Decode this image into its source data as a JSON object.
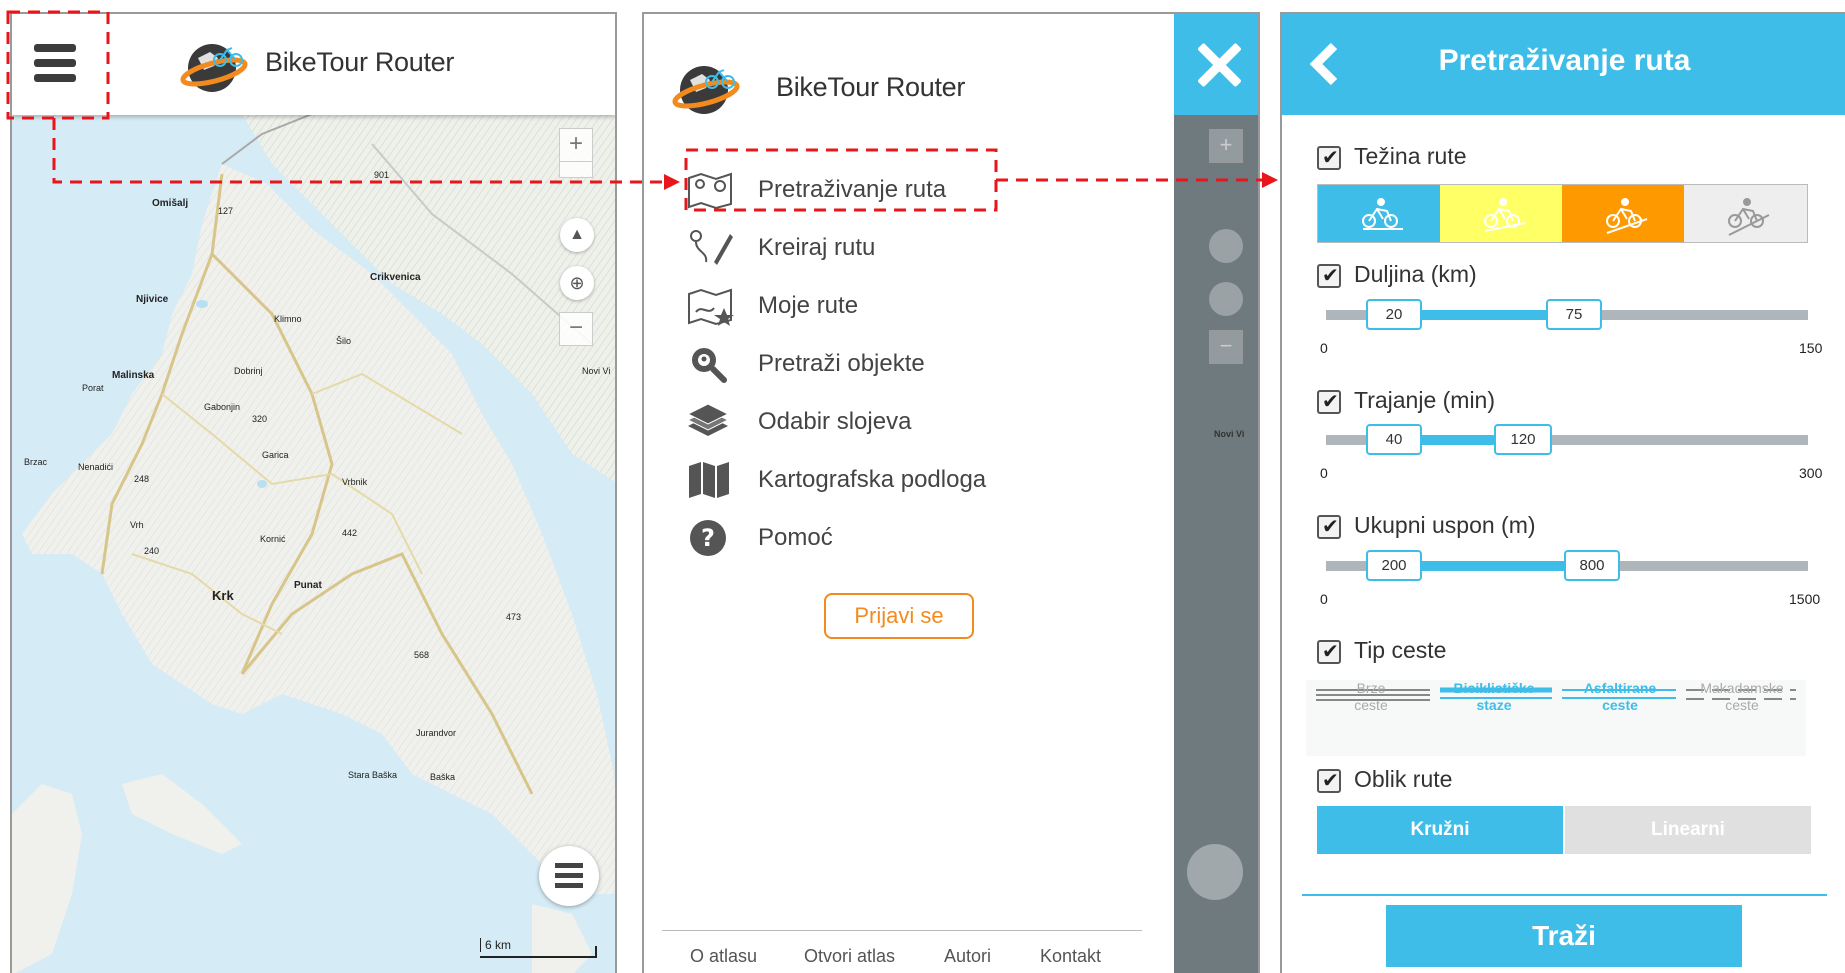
{
  "app": {
    "brand": "BikeTour Router"
  },
  "map": {
    "places": [
      "Omišalj",
      "Njivice",
      "Malinska",
      "Porat",
      "Dobrinj",
      "Gabonjin",
      "Brzac",
      "Nenadići",
      "Vrh",
      "Garica",
      "Vrbnik",
      "Kornić",
      "Krk",
      "Punat",
      "Stara Baška",
      "Baška",
      "Jurandvor",
      "Crikvenica",
      "Klimno",
      "Šilo",
      "Novi Vi"
    ],
    "elevations": [
      "901",
      "127",
      "320",
      "248",
      "240",
      "442",
      "473",
      "568"
    ],
    "scale": "6 km",
    "zoom_in": "+",
    "zoom_out": "−"
  },
  "menu": {
    "items": [
      {
        "label": "Pretraživanje ruta",
        "icon": "map-search-icon"
      },
      {
        "label": "Kreiraj rutu",
        "icon": "draw-route-icon"
      },
      {
        "label": "Moje rute",
        "icon": "my-routes-icon"
      },
      {
        "label": "Pretraži objekte",
        "icon": "magnifier-pin-icon"
      },
      {
        "label": "Odabir slojeva",
        "icon": "layers-icon"
      },
      {
        "label": "Kartografska podloga",
        "icon": "basemap-icon"
      },
      {
        "label": "Pomoć",
        "icon": "help-icon"
      }
    ],
    "login": "Prijavi se",
    "footer": [
      "O atlasu",
      "Otvori atlas",
      "Autori",
      "Kontakt"
    ]
  },
  "search": {
    "title": "Pretraživanje ruta",
    "difficulty": {
      "label": "Težina rute",
      "checked": true,
      "colors": [
        "#3dbde8",
        "#ffff66",
        "#ff9900",
        "#eeeeee"
      ]
    },
    "length": {
      "label": "Duljina (km)",
      "checked": true,
      "low": "20",
      "high": "75",
      "min": "0",
      "max": "150"
    },
    "duration": {
      "label": "Trajanje (min)",
      "checked": true,
      "low": "40",
      "high": "120",
      "min": "0",
      "max": "300"
    },
    "ascent": {
      "label": "Ukupni uspon (m)",
      "checked": true,
      "low": "200",
      "high": "800",
      "min": "0",
      "max": "1500"
    },
    "road_type": {
      "label": "Tip ceste",
      "checked": true,
      "types": [
        {
          "line1": "Brze",
          "line2": "ceste",
          "active": false
        },
        {
          "line1": "Biciklističke",
          "line2": "staze",
          "active": true
        },
        {
          "line1": "Asfaltirane",
          "line2": "ceste",
          "active": true
        },
        {
          "line1": "Makadamske",
          "line2": "ceste",
          "active": false
        }
      ]
    },
    "shape": {
      "label": "Oblik rute",
      "checked": true,
      "options": [
        "Kružni",
        "Linearni"
      ],
      "selected": "Kružni"
    },
    "submit": "Traži"
  },
  "colors": {
    "accent": "#3dbde8",
    "login": "#f28a1e",
    "annotation": "#e8161b"
  }
}
